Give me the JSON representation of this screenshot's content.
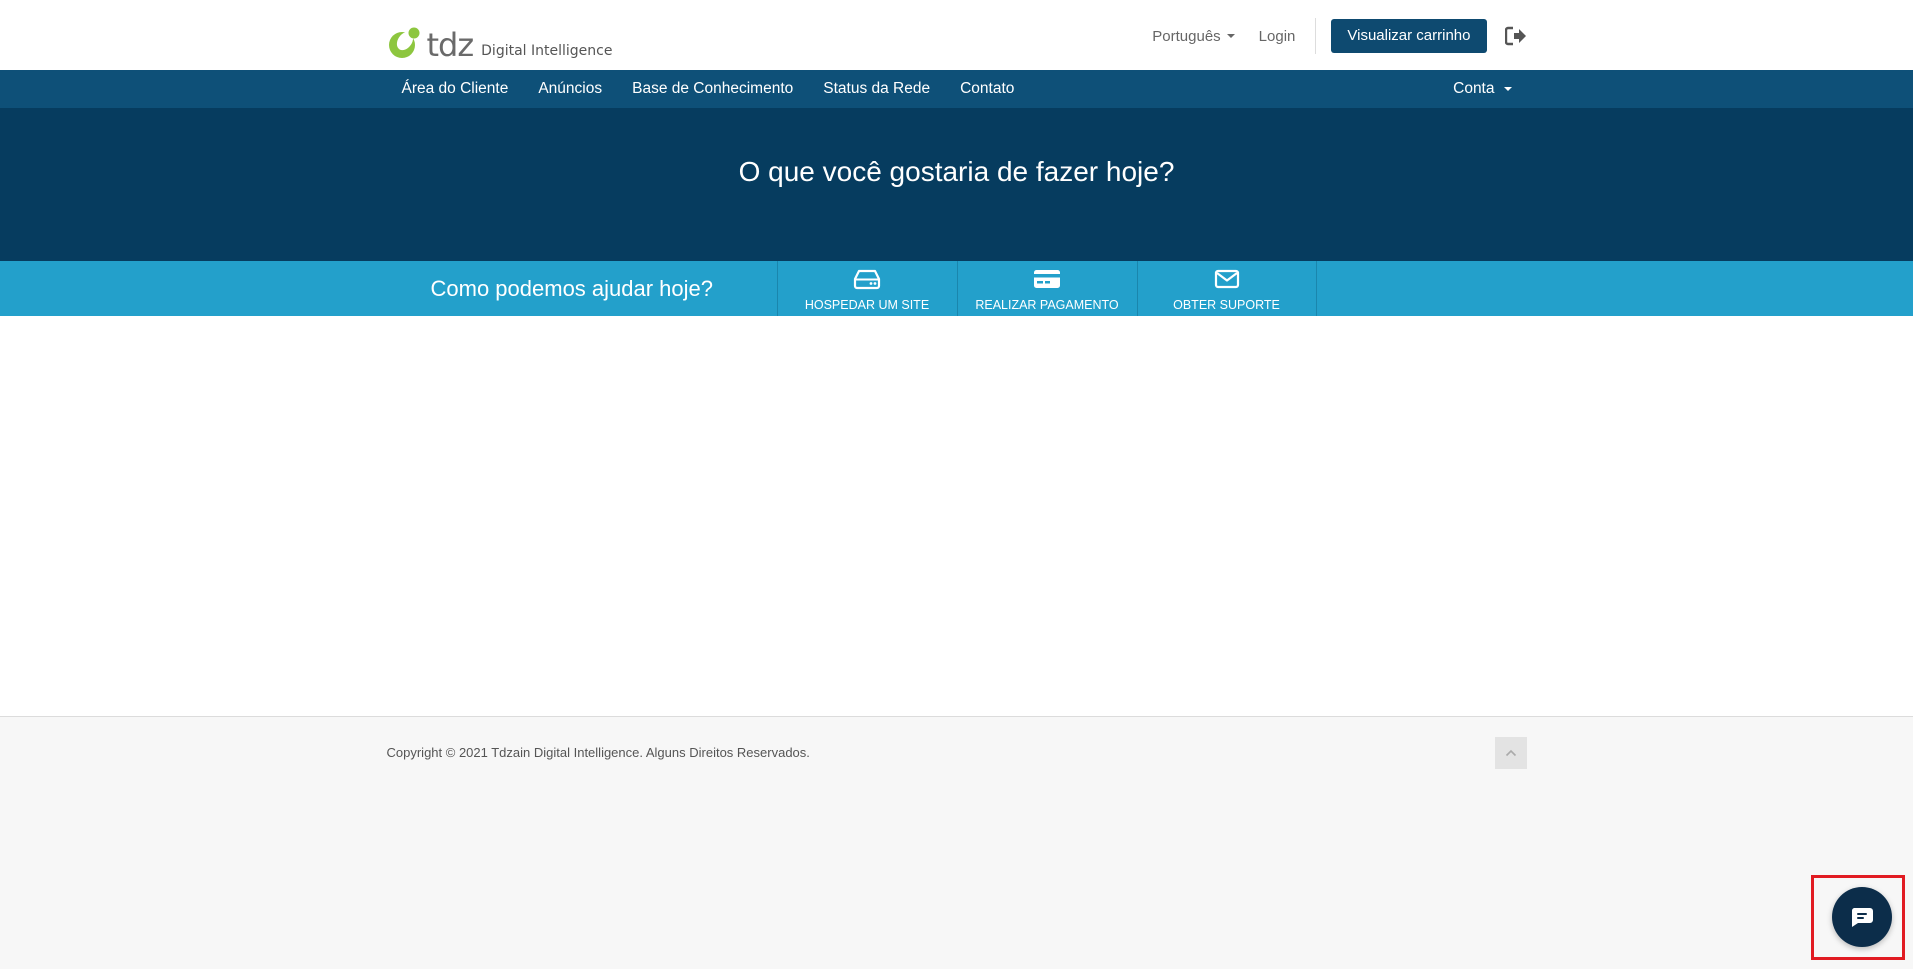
{
  "header": {
    "logo_text": "tdz",
    "logo_tagline": "Digital Intelligence",
    "language_label": "Português",
    "login_label": "Login",
    "cart_button_label": "Visualizar carrinho"
  },
  "nav": {
    "items": [
      {
        "label": "Área do Cliente"
      },
      {
        "label": "Anúncios"
      },
      {
        "label": "Base de Conhecimento"
      },
      {
        "label": "Status da Rede"
      },
      {
        "label": "Contato"
      }
    ],
    "account_label": "Conta"
  },
  "hero": {
    "title": "O que você gostaria de fazer hoje?"
  },
  "shortcuts": {
    "title": "Como podemos ajudar hoje?",
    "items": [
      {
        "label": "HOSPEDAR UM SITE",
        "icon": "hdd-icon"
      },
      {
        "label": "REALIZAR PAGAMENTO",
        "icon": "credit-card-icon"
      },
      {
        "label": "OBTER SUPORTE",
        "icon": "envelope-icon"
      }
    ]
  },
  "footer": {
    "copyright": "Copyright © 2021 Tdzain Digital Intelligence. Alguns Direitos Reservados."
  },
  "colors": {
    "navbar": "#0e5078",
    "hero": "#063c5f",
    "shortcuts": "#23a0cb",
    "cart_button": "#0e4a70",
    "logo_green": "#8dc63f",
    "chat_button": "#0c2d4a",
    "highlight": "#e11b22"
  }
}
